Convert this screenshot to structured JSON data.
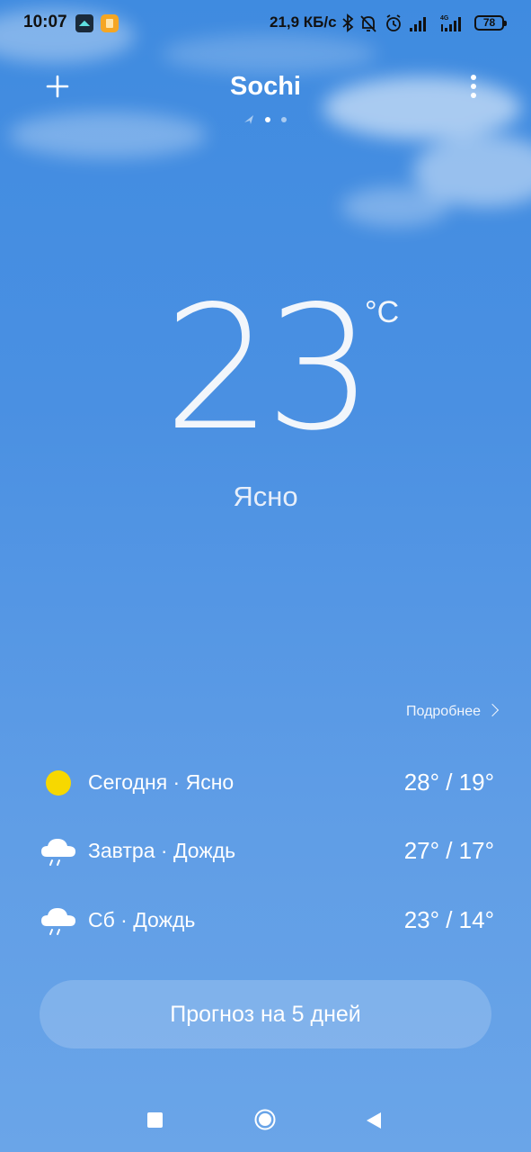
{
  "status_bar": {
    "time": "10:07",
    "speed": "21,9 КБ/с",
    "network_label": "4G",
    "battery": "78",
    "icons": [
      "app-icon-1",
      "app-icon-2",
      "bluetooth-icon",
      "mute-icon",
      "alarm-icon",
      "signal-icon",
      "signal-4g-icon",
      "battery-icon"
    ]
  },
  "header": {
    "city": "Sochi",
    "add_icon": "plus-icon",
    "menu_icon": "more-vertical-icon",
    "pages": [
      "location-arrow",
      "dot-active",
      "dot"
    ]
  },
  "current": {
    "temperature": "23",
    "unit": "°C",
    "condition": "Ясно"
  },
  "details_link": {
    "label": "Подробнее"
  },
  "forecast": [
    {
      "label": "Сегодня · Ясно",
      "temps": "28° / 19°",
      "icon": "sun-icon"
    },
    {
      "label": "Завтра · Дождь",
      "temps": "27° / 17°",
      "icon": "rain-cloud-icon"
    },
    {
      "label": "Сб · Дождь",
      "temps": "23° / 14°",
      "icon": "rain-cloud-icon"
    }
  ],
  "five_day_button": {
    "label": "Прогноз на 5 дней"
  },
  "nav_bar": {
    "icons": [
      "recents-square-icon",
      "home-circle-icon",
      "back-triangle-icon"
    ]
  },
  "colors": {
    "background_top": "#3f8be0",
    "background_bottom": "#6aa5e8",
    "sun": "#f7d800",
    "text": "#ffffff"
  }
}
